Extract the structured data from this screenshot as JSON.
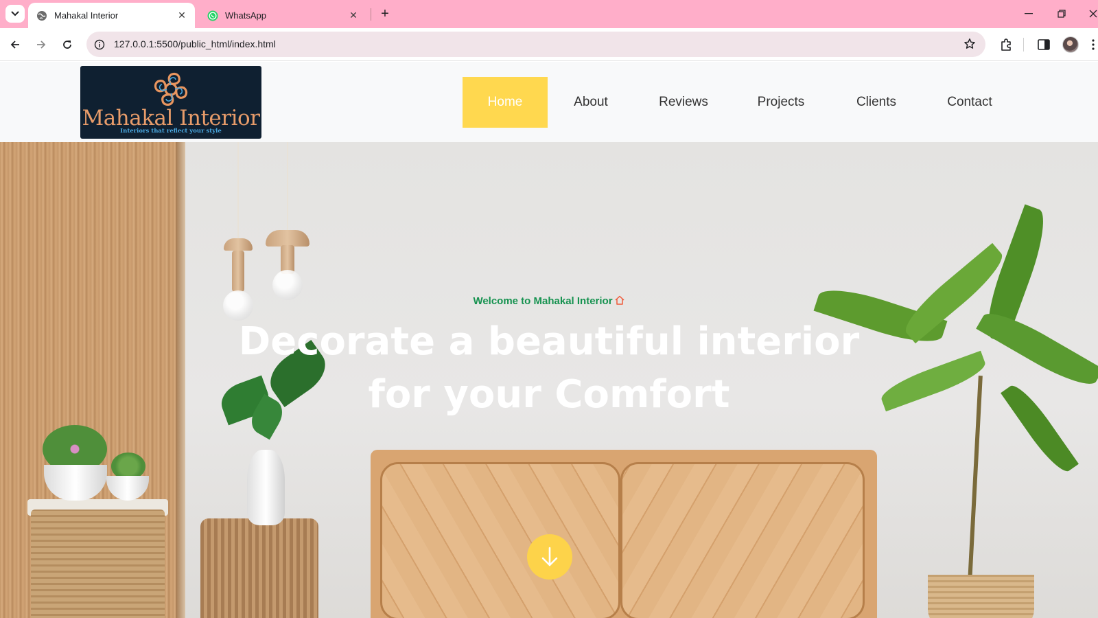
{
  "browser": {
    "tabs": [
      {
        "title": "Mahakal Interior",
        "active": true,
        "icon": "globe-icon"
      },
      {
        "title": "WhatsApp",
        "active": false,
        "icon": "whatsapp-icon"
      }
    ],
    "url": "127.0.0.1:5500/public_html/index.html",
    "tabstrip_color": "#ffaec9"
  },
  "site": {
    "logo": {
      "name": "Mahakal Interior",
      "tagline": "Interiors that reflect your style"
    },
    "nav": [
      {
        "label": "Home",
        "active": true
      },
      {
        "label": "About",
        "active": false
      },
      {
        "label": "Reviews",
        "active": false
      },
      {
        "label": "Projects",
        "active": false
      },
      {
        "label": "Clients",
        "active": false
      },
      {
        "label": "Contact",
        "active": false
      }
    ],
    "hero": {
      "welcome": "Welcome to Mahakal Interior",
      "title_line1": "Decorate a beautiful interior",
      "title_line2": "for your Comfort",
      "scroll_icon": "arrow-down-icon"
    },
    "colors": {
      "accent": "#ffd84f",
      "welcome_text": "#15924f",
      "logo_bg": "#0f2031",
      "logo_text": "#e89c6a"
    }
  }
}
